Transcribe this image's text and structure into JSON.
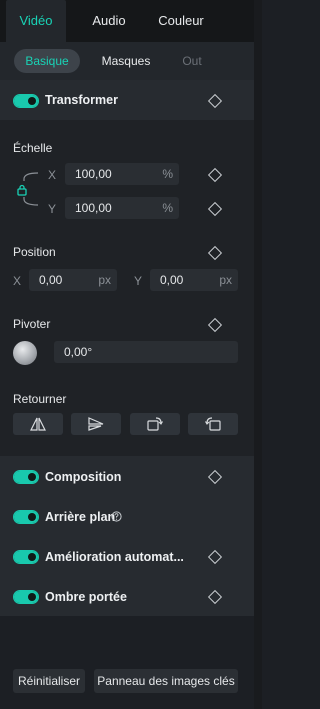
{
  "tabs": [
    "Vidéo",
    "Audio",
    "Couleur"
  ],
  "subtabs": [
    "Basique",
    "Masques",
    "Out"
  ],
  "transformer": {
    "title": "Transformer",
    "scale_label": "Échelle",
    "scale_x_axis": "X",
    "scale_x_value": "100,00",
    "scale_x_unit": "%",
    "scale_y_axis": "Y",
    "scale_y_value": "100,00",
    "scale_y_unit": "%",
    "position_label": "Position",
    "pos_x_axis": "X",
    "pos_x_value": "0,00",
    "pos_x_unit": "px",
    "pos_y_axis": "Y",
    "pos_y_value": "0,00",
    "pos_y_unit": "px",
    "rotate_label": "Pivoter",
    "rotate_value": "0,00°",
    "flip_label": "Retourner"
  },
  "sections": {
    "composition": "Composition",
    "background": "Arrière plan",
    "auto_enhance": "Amélioration automat...",
    "drop_shadow": "Ombre portée"
  },
  "footer": {
    "reset": "Réinitialiser",
    "keyframe_panel": "Panneau des images clés"
  },
  "colors": {
    "accent": "#19d3b6",
    "toggle": "#19c9ad",
    "panel": "#1f2226",
    "band": "#272b30"
  }
}
